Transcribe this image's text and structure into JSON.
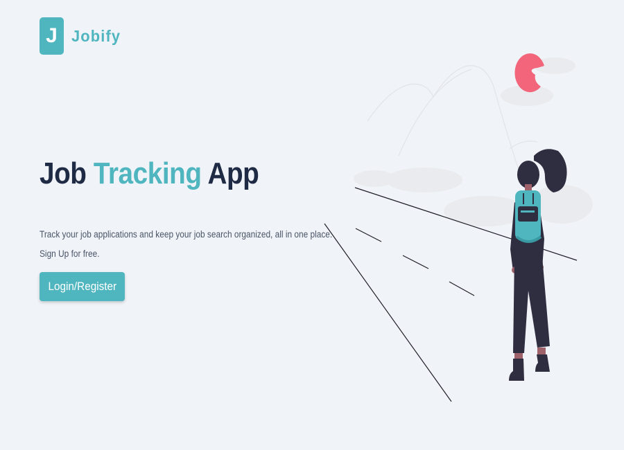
{
  "brand": {
    "logo_letter": "J",
    "name": "Jobify"
  },
  "hero": {
    "title_part1": "Job ",
    "title_accent": "Tracking",
    "title_part2": " App",
    "description_line1": "Track your job applications and keep your job search organized, all in one place.",
    "description_line2": "Sign Up for free.",
    "cta_label": "Login/Register"
  },
  "colors": {
    "primary": "#4fb5bf",
    "heading": "#1f2a44",
    "text": "#4a5568",
    "background": "#f0f3f7",
    "sun": "#f2657a",
    "figure_dark": "#2f2e41"
  },
  "illustration": {
    "name": "woman-with-backpack-on-road-illustration"
  }
}
